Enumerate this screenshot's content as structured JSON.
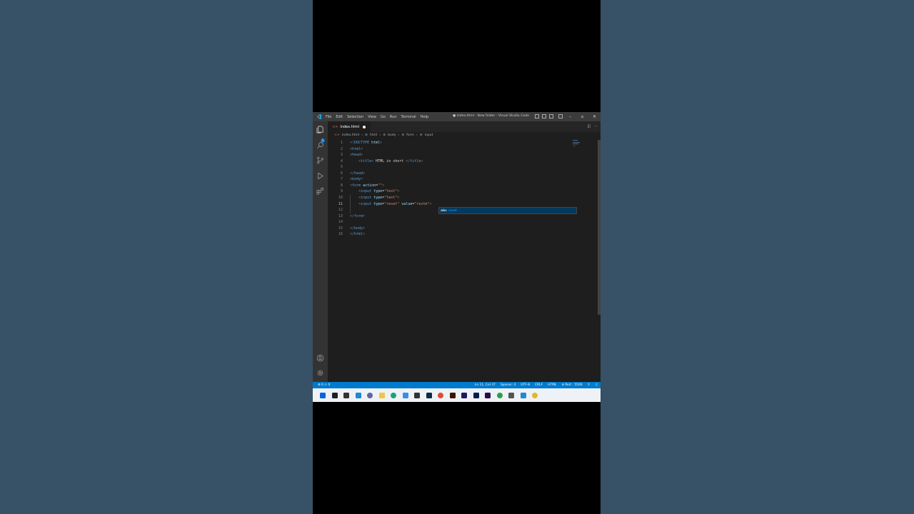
{
  "window": {
    "title": "● index.html - New folder - Visual Studio Code",
    "menu": [
      "File",
      "Edit",
      "Selection",
      "View",
      "Go",
      "Run",
      "Terminal",
      "Help"
    ]
  },
  "activity_bar": {
    "explorer_badge": "1",
    "items": [
      "explorer-icon",
      "search-icon",
      "source-control-icon",
      "run-debug-icon",
      "extensions-icon",
      "account-icon",
      "settings-gear-icon"
    ]
  },
  "tab": {
    "label": "index.html"
  },
  "breadcrumb": [
    "index.html",
    "html",
    "body",
    "form",
    "input"
  ],
  "editor": {
    "active_line": 11,
    "lines": [
      {
        "n": "1",
        "parts": [
          [
            "p",
            "<!"
          ],
          [
            "t",
            "DOCTYPE"
          ],
          [
            "txt",
            " "
          ],
          [
            "a",
            "html"
          ],
          [
            "p",
            ">"
          ]
        ]
      },
      {
        "n": "2",
        "parts": [
          [
            "p",
            "<"
          ],
          [
            "t",
            "html"
          ],
          [
            "p",
            ">"
          ]
        ]
      },
      {
        "n": "3",
        "parts": [
          [
            "p",
            "<"
          ],
          [
            "t",
            "head"
          ],
          [
            "p",
            ">"
          ]
        ]
      },
      {
        "n": "4",
        "parts": [
          [
            "txt",
            "    "
          ],
          [
            "p",
            "<"
          ],
          [
            "t",
            "title"
          ],
          [
            "p",
            ">"
          ],
          [
            "txt",
            " HTML in short "
          ],
          [
            "p",
            "</"
          ],
          [
            "t",
            "title"
          ],
          [
            "p",
            ">"
          ]
        ]
      },
      {
        "n": "5",
        "parts": []
      },
      {
        "n": "6",
        "parts": [
          [
            "p",
            "</"
          ],
          [
            "t",
            "head"
          ],
          [
            "p",
            ">"
          ]
        ]
      },
      {
        "n": "7",
        "parts": [
          [
            "p",
            "<"
          ],
          [
            "t",
            "body"
          ],
          [
            "p",
            ">"
          ]
        ]
      },
      {
        "n": "8",
        "parts": [
          [
            "p",
            "<"
          ],
          [
            "t",
            "form"
          ],
          [
            "txt",
            " "
          ],
          [
            "a",
            "action"
          ],
          [
            "txt",
            "="
          ],
          [
            "s",
            "\"\""
          ],
          [
            "p",
            ">"
          ]
        ]
      },
      {
        "n": "9",
        "parts": [
          [
            "txt",
            "    "
          ],
          [
            "p",
            "<"
          ],
          [
            "t",
            "input"
          ],
          [
            "txt",
            " "
          ],
          [
            "a",
            "type"
          ],
          [
            "txt",
            "="
          ],
          [
            "s",
            "\"text\""
          ],
          [
            "p",
            ">"
          ]
        ]
      },
      {
        "n": "10",
        "parts": [
          [
            "txt",
            "    "
          ],
          [
            "p",
            "<"
          ],
          [
            "t",
            "input"
          ],
          [
            "txt",
            " "
          ],
          [
            "a",
            "type"
          ],
          [
            "txt",
            "="
          ],
          [
            "s",
            "\"text\""
          ],
          [
            "p",
            ">"
          ]
        ]
      },
      {
        "n": "11",
        "parts": [
          [
            "txt",
            "    "
          ],
          [
            "p",
            "<"
          ],
          [
            "t",
            "input"
          ],
          [
            "txt",
            " "
          ],
          [
            "a",
            "type"
          ],
          [
            "txt",
            "="
          ],
          [
            "s",
            "\"reset\""
          ],
          [
            "txt",
            " "
          ],
          [
            "a",
            "value"
          ],
          [
            "txt",
            "="
          ],
          [
            "s",
            "\"restm\""
          ],
          [
            "p",
            ">"
          ]
        ]
      },
      {
        "n": "12",
        "parts": []
      },
      {
        "n": "13",
        "parts": [
          [
            "p",
            "</"
          ],
          [
            "t",
            "form"
          ],
          [
            "p",
            ">"
          ]
        ]
      },
      {
        "n": "14",
        "parts": []
      },
      {
        "n": "15",
        "parts": [
          [
            "p",
            "</"
          ],
          [
            "t",
            "body"
          ],
          [
            "p",
            ">"
          ]
        ]
      },
      {
        "n": "16",
        "parts": [
          [
            "p",
            "</"
          ],
          [
            "t",
            "html"
          ],
          [
            "p",
            ">"
          ]
        ]
      }
    ]
  },
  "suggest": {
    "kind": "abc",
    "item": "reset"
  },
  "statusbar": {
    "problems": "⊗ 0 ⚠ 0",
    "position": "Ln 11, Col 37",
    "spaces": "Spaces: 4",
    "encoding": "UTF-8",
    "eol": "CRLF",
    "language": "HTML",
    "port": "⊘ Port : 5500"
  },
  "taskbar": {
    "icons": [
      {
        "name": "start-icon",
        "color": "#0a66d8"
      },
      {
        "name": "search-icon",
        "color": "#222222"
      },
      {
        "name": "task-view-icon",
        "color": "#333333"
      },
      {
        "name": "widgets-icon",
        "color": "#1a8ad4"
      },
      {
        "name": "chat-icon",
        "color": "#6264a7"
      },
      {
        "name": "file-explorer-icon",
        "color": "#f5c542"
      },
      {
        "name": "edge-icon",
        "color": "#1aa27c"
      },
      {
        "name": "store-icon",
        "color": "#3a8ee6"
      },
      {
        "name": "app-icon",
        "color": "#333333"
      },
      {
        "name": "photoshop-icon",
        "color": "#0b2b45"
      },
      {
        "name": "chrome-icon",
        "color": "#e04a3b"
      },
      {
        "name": "illustrator-icon",
        "color": "#3a1500"
      },
      {
        "name": "media-encoder-icon",
        "color": "#1c1b5e"
      },
      {
        "name": "audition-icon",
        "color": "#00204a"
      },
      {
        "name": "premiere-icon",
        "color": "#2a0a4a"
      },
      {
        "name": "chrome-2-icon",
        "color": "#2e9d4b"
      },
      {
        "name": "notes-icon",
        "color": "#555555"
      },
      {
        "name": "vscode-icon",
        "color": "#1f8ad2"
      },
      {
        "name": "chrome-3-icon",
        "color": "#e0b92b"
      }
    ]
  }
}
